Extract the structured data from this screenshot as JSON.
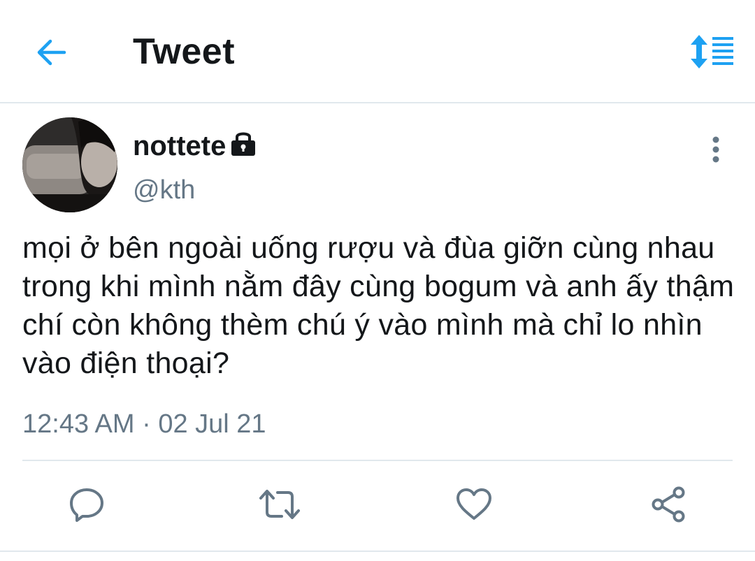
{
  "header": {
    "title": "Tweet",
    "back_icon": "back-arrow-icon",
    "sort_icon": "sort-toggle-icon"
  },
  "tweet": {
    "display_name": "nottete",
    "handle": "@kth",
    "protected_icon": "lock-icon",
    "text": "mọi ở bên ngoài uống rượu và đùa giỡn cùng nhau trong khi mình nằm đây cùng bogum và anh ấy thậm chí còn không thèm chú ý vào mình mà chỉ lo nhìn vào điện thoại?",
    "timestamp": "12:43 AM · 02 Jul 21"
  },
  "actions": {
    "reply_icon": "reply-icon",
    "retweet_icon": "retweet-icon",
    "like_icon": "heart-icon",
    "share_icon": "share-icon"
  },
  "colors": {
    "accent": "#1da1f2",
    "muted": "#657786",
    "text": "#14171a",
    "divider": "#e1e8ed"
  }
}
